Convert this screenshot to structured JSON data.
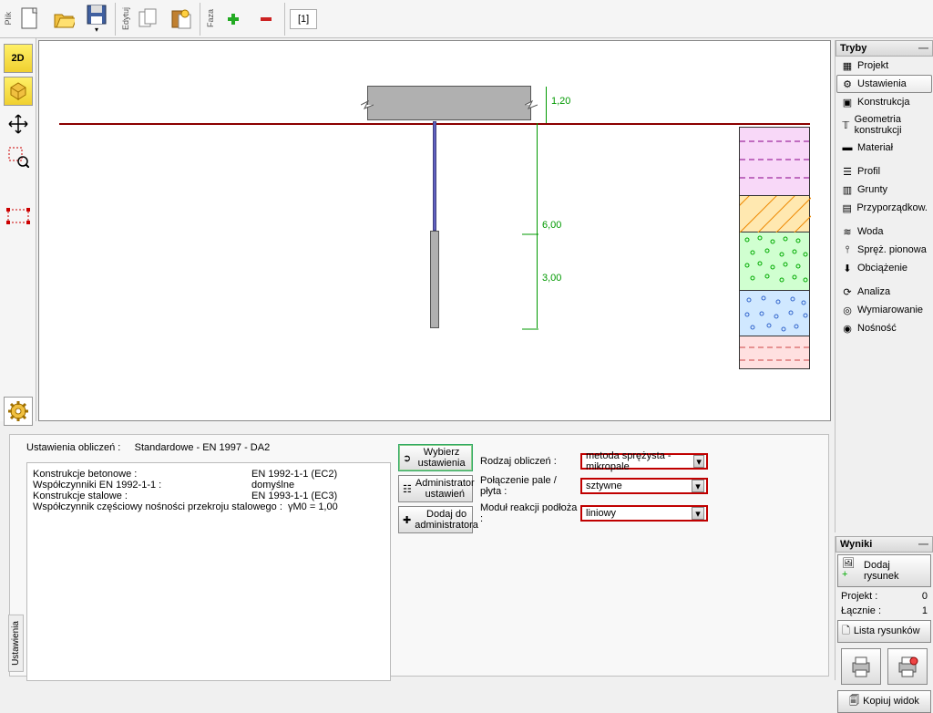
{
  "toolbar": {
    "file": "Plik",
    "edit": "Edytuj",
    "phase": "Faza",
    "tab1": "[1]"
  },
  "view": {
    "btn2d": "2D",
    "btn3d": "3D"
  },
  "tree": {
    "head_modes": "Tryby",
    "projekt": "Projekt",
    "ustawienia": "Ustawienia",
    "konstrukcja": "Konstrukcja",
    "geometria": "Geometria konstrukcji",
    "material": "Materiał",
    "profil": "Profil",
    "grunty": "Grunty",
    "przyporz": "Przyporządkow.",
    "woda": "Woda",
    "sprez": "Spręż. pionowa",
    "obciazenie": "Obciążenie",
    "analiza": "Analiza",
    "wymiarowanie": "Wymiarowanie",
    "nosnosc": "Nośność"
  },
  "dims": {
    "d1": "1,20",
    "d2": "6,00",
    "d3": "3,00"
  },
  "bottom": {
    "tab": "Ustawienia",
    "title": "Ustawienia obliczeń :",
    "title_val": "Standardowe - EN 1997 - DA2",
    "rows": [
      {
        "l": "Konstrukcje betonowe :",
        "v": "EN 1992-1-1 (EC2)"
      },
      {
        "l": "Współczynniki EN 1992-1-1 :",
        "v": "domyślne"
      },
      {
        "l": "Konstrukcje stalowe :",
        "v": "EN 1993-1-1 (EC3)"
      },
      {
        "l": "Współczynnik częściowy nośności przekroju stalowego :",
        "v": "γM0 = 1,00"
      }
    ],
    "btn_select": "Wybierz ustawienia",
    "btn_admin": "Administrator ustawień",
    "btn_add": "Dodaj do administratora",
    "form": {
      "rodzaj": "Rodzaj obliczeń :",
      "rodzaj_v": "metoda sprężysta - mikropale",
      "polaczenie": "Połączenie pale / płyta :",
      "polaczenie_v": "sztywne",
      "modul": "Moduł reakcji podłoża :",
      "modul_v": "liniowy"
    }
  },
  "results": {
    "head": "Wyniki",
    "add": "Dodaj rysunek",
    "proj": "Projekt :",
    "proj_v": "0",
    "total": "Łącznie :",
    "total_v": "1",
    "list": "Lista rysunków",
    "copy": "Kopiuj widok"
  }
}
